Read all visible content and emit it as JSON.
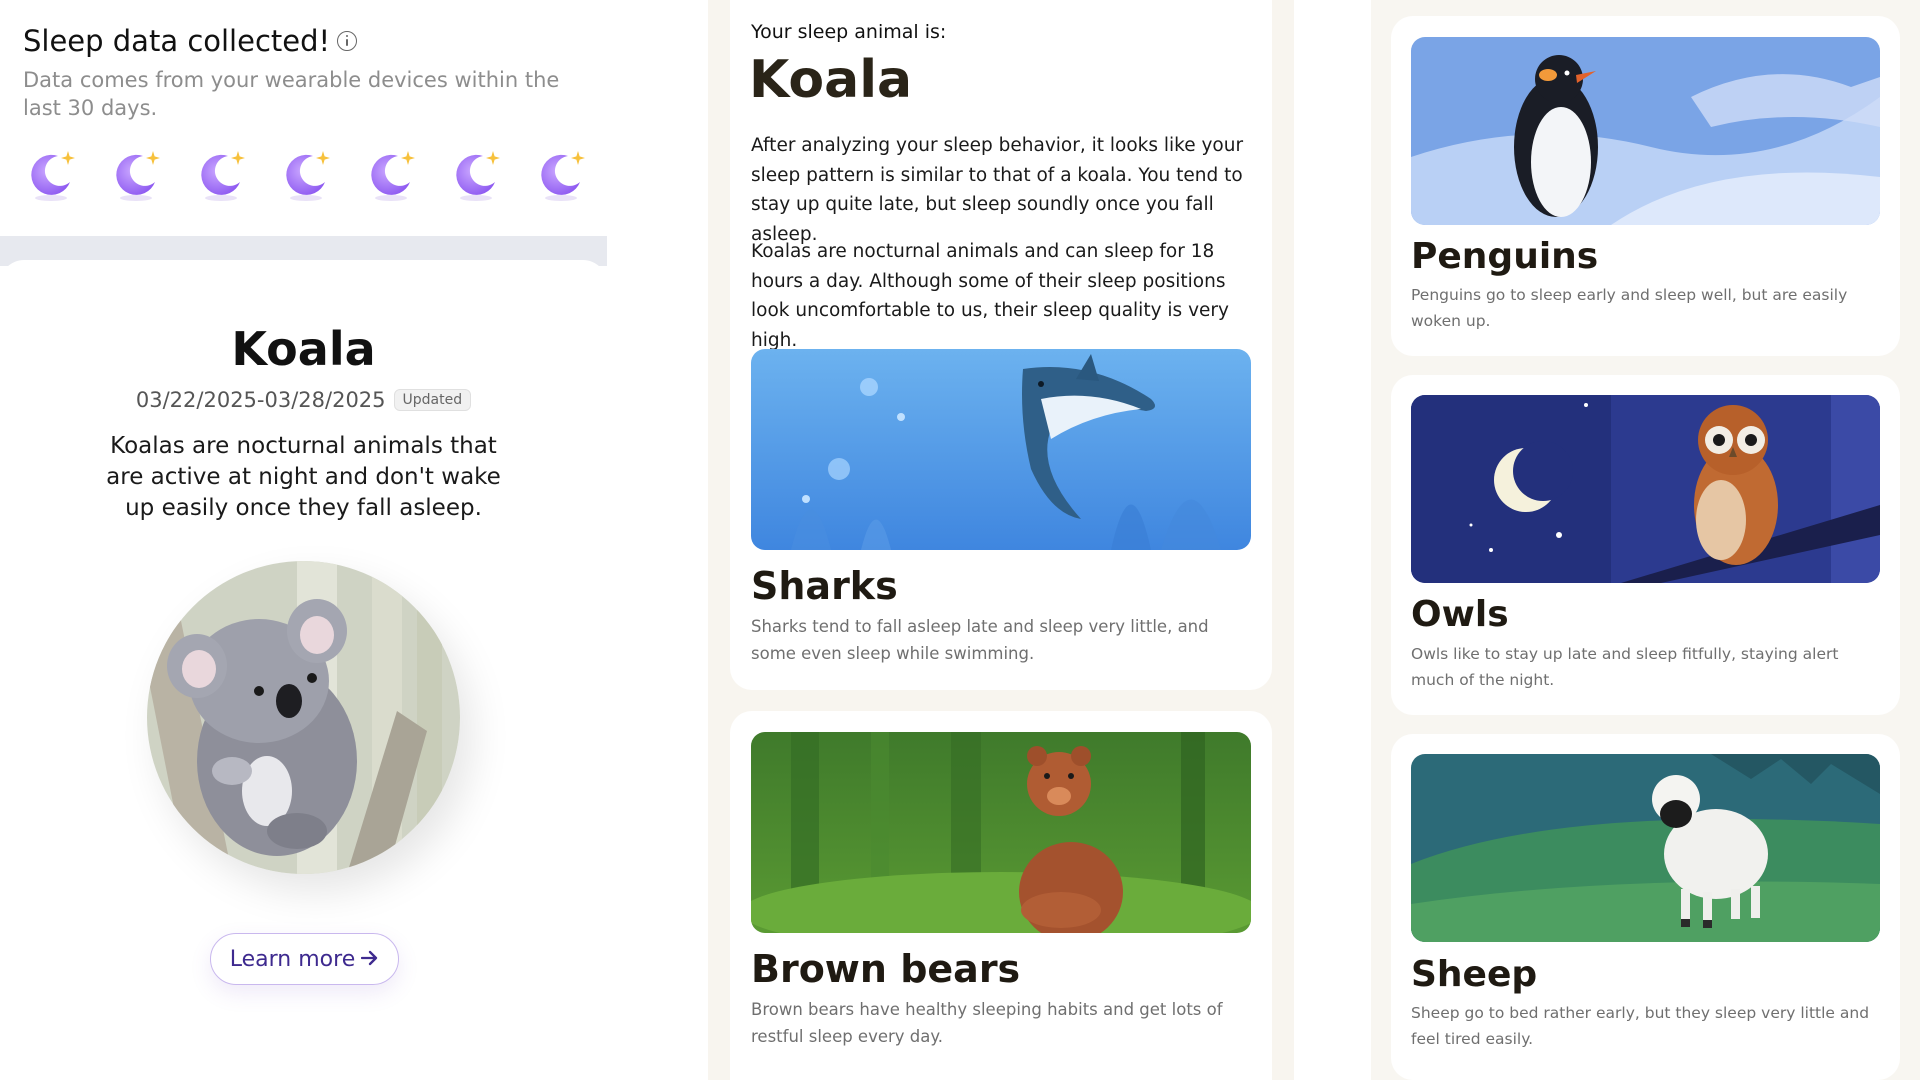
{
  "sleep_collected": {
    "title": "Sleep data collected!",
    "subtitle": "Data comes from your wearable devices within the last 30 days.",
    "moon_icon": "moon-star-icon",
    "moon_count": 7
  },
  "koala_summary": {
    "name": "Koala",
    "date_range": "03/22/2025-03/28/2025",
    "badge": "Updated",
    "description": "Koalas are nocturnal animals that are active at night and don't wake up easily once they fall asleep.",
    "learn_more": "Learn more",
    "arrow_icon": "arrow-right-icon"
  },
  "result": {
    "label": "Your sleep animal is:",
    "animal": "Koala",
    "paragraph1": "After analyzing your sleep behavior, it looks like your sleep pattern is similar to that of a koala. You tend to stay up quite late, but sleep soundly once you fall asleep.",
    "paragraph2": "Koalas are nocturnal animals and can sleep for 18 hours a day. Although some of their sleep positions look uncomfortable to us, their sleep quality is very high."
  },
  "animals": [
    {
      "name": "Sharks",
      "description": "Sharks tend to fall asleep late and sleep very little, and some even sleep while swimming."
    },
    {
      "name": "Brown bears",
      "description": "Brown bears have healthy sleeping habits and get lots of restful sleep every day."
    },
    {
      "name": "Penguins",
      "description": "Penguins go to sleep early and sleep well, but are easily woken up."
    },
    {
      "name": "Owls",
      "description": "Owls like to stay up late and sleep fitfully, staying alert much of the night."
    },
    {
      "name": "Sheep",
      "description": "Sheep go to bed rather early, but they sleep very little and feel tired easily."
    }
  ],
  "colors": {
    "accent_purple": "#8b5cf6",
    "button_text": "#3e2a8f",
    "panel_bg": "#f8f5ef"
  }
}
